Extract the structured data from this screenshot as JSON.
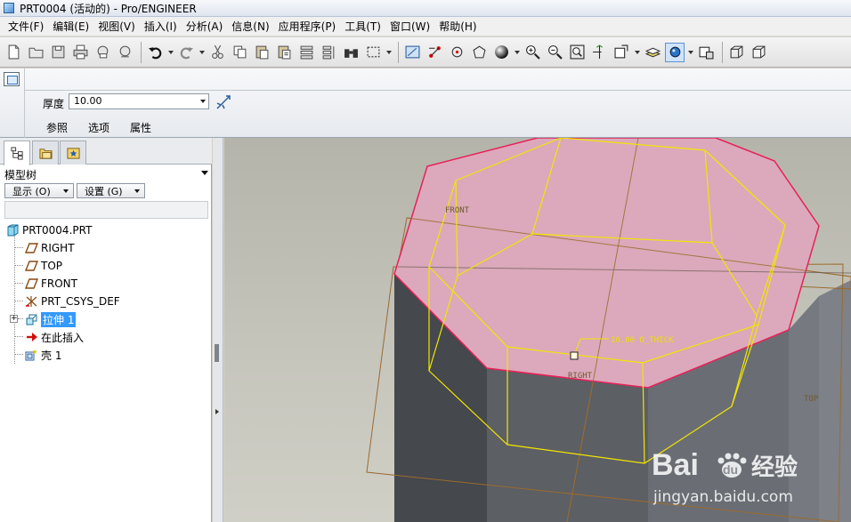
{
  "window": {
    "title": "PRT0004 (活动的) - Pro/ENGINEER"
  },
  "menu": [
    "文件(F)",
    "编辑(E)",
    "视图(V)",
    "插入(I)",
    "分析(A)",
    "信息(N)",
    "应用程序(P)",
    "工具(T)",
    "窗口(W)",
    "帮助(H)"
  ],
  "dashboard": {
    "thickness_label": "厚度",
    "thickness_value": "10.00",
    "tabs": [
      "参照",
      "选项",
      "属性"
    ]
  },
  "model_tree": {
    "header": "模型树",
    "show_button": "显示 (O)",
    "settings_button": "设置 (G)",
    "items": [
      {
        "label": "PRT0004.PRT",
        "icon": "part-icon"
      },
      {
        "label": "RIGHT",
        "icon": "datum-plane-icon"
      },
      {
        "label": "TOP",
        "icon": "datum-plane-icon"
      },
      {
        "label": "FRONT",
        "icon": "datum-plane-icon"
      },
      {
        "label": "PRT_CSYS_DEF",
        "icon": "coordinate-system-icon"
      },
      {
        "label": "拉伸 1",
        "icon": "extrude-icon",
        "selected": true
      },
      {
        "label": "在此插入",
        "icon": "insert-here-arrow-icon"
      },
      {
        "label": "壳 1",
        "icon": "shell-icon"
      }
    ]
  },
  "viewport": {
    "labels": {
      "front": "FRONT",
      "right": "RIGHT",
      "top": "TOP",
      "dimension": "10.00 O_THICK"
    },
    "watermark": {
      "brand_a": "Bai",
      "brand_b": "du",
      "brand_c": "经验",
      "url": "jingyan.baidu.com"
    }
  },
  "colors": {
    "top_face": "#dba9bb",
    "side_face": "#5e6166",
    "preview_lines": "#f2e600",
    "datum_lines": "#9a6b2e",
    "selection": "#3399ff"
  }
}
